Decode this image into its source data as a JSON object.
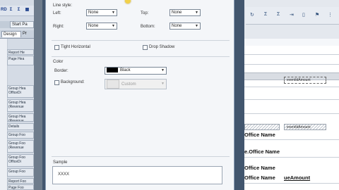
{
  "left_panel": {
    "toolbar_glyphs": [
      "RD",
      "Σ",
      "Σ",
      "▦"
    ],
    "start_tab": "Start Pa",
    "tabs": [
      "Design",
      "Pr"
    ],
    "bands": [
      "Report He",
      "Page Hea",
      "Group Hea OfficeDi",
      "Group Hea (Revenue",
      "Group Hea (Revenue",
      "Details",
      "Group Foo",
      "Group Foo (Revenue",
      "Group Foo OfficeDi",
      "Group Foo",
      "Report Foo",
      "Page Foo"
    ]
  },
  "right_panel": {
    "toolbar_glyphs": [
      "↻",
      "Σ",
      "Σ",
      "⇥",
      "▯",
      "⚑",
      "⋮"
    ],
    "texts": {
      "field_small": "eventIdAmount",
      "field_small2": "eventIdAmount",
      "office_name1": "Office Name",
      "office_name2": "e.Office Name",
      "office_name3": "Office Name",
      "office_name4": "Office Name",
      "amount": "ueAmount"
    }
  },
  "dialog": {
    "line_style": {
      "title": "Line style:",
      "left_label": "Left:",
      "left_value": "None",
      "top_label": "Top:",
      "top_value": "None",
      "right_label": "Right:",
      "right_value": "None",
      "bottom_label": "Bottom:",
      "bottom_value": "None"
    },
    "tight_horizontal": "Tight Horizontal",
    "drop_shadow": "Drop Shadow",
    "color": {
      "title": "Color",
      "border_label": "Border:",
      "border_value": "Black",
      "border_swatch": "#000000",
      "background_label": "Background:",
      "background_value": "Custom",
      "background_swatch": "#e6e6e6"
    },
    "sample": {
      "title": "Sample",
      "text": "XXXX"
    }
  }
}
